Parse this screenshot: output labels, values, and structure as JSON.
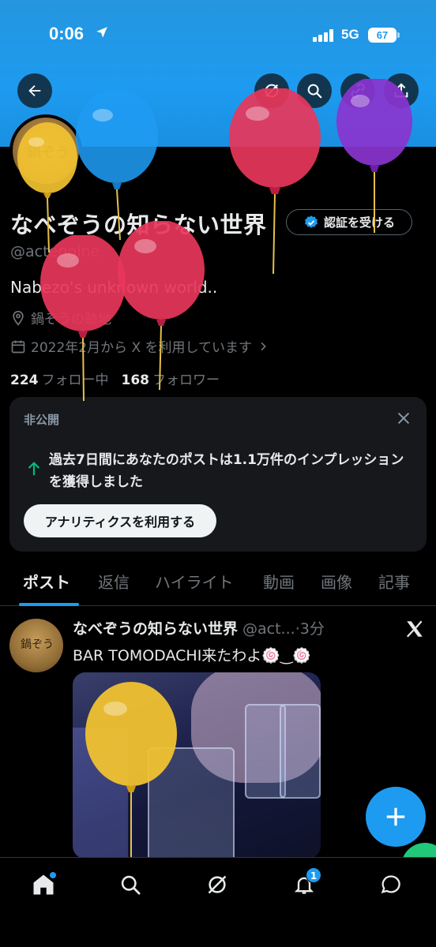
{
  "status_bar": {
    "time": "0:06",
    "network": "5G",
    "battery": "67"
  },
  "header": {
    "back": "back",
    "grok": "grok",
    "search": "search",
    "link": "link",
    "share": "share"
  },
  "profile": {
    "name": "なべぞうの知らない世界",
    "handle": "@actengine",
    "bio": "Nabezo's unknown world..",
    "location": "鍋ぞうの跡地",
    "joined": "2022年2月から X を利用しています",
    "following_count": "224",
    "following_label": "フォロー中",
    "followers_count": "168",
    "followers_label": "フォロワー",
    "verify_button": "認証を受ける",
    "avatar_text": "鍋ぞう"
  },
  "insight_card": {
    "label": "非公開",
    "message": "過去7日間にあなたのポストは1.1万件のインプレッションを獲得しました",
    "button": "アナリティクスを利用する"
  },
  "tabs": [
    "ポスト",
    "返信",
    "ハイライト",
    "動画",
    "画像",
    "記事"
  ],
  "post": {
    "author": "なべぞうの知らない世界",
    "handle": "@act...",
    "time": "·3分",
    "text": "BAR TOMODACHI来たわよ🍥‿🍥"
  },
  "colors": {
    "accent": "#1d9bf0",
    "background": "#000000",
    "card": "#16181c",
    "muted": "#71767b"
  },
  "nav": {
    "home": "home-icon",
    "search": "search-icon",
    "grok": "grok-icon",
    "notifications_badge": "1",
    "messages": "mail-icon"
  }
}
